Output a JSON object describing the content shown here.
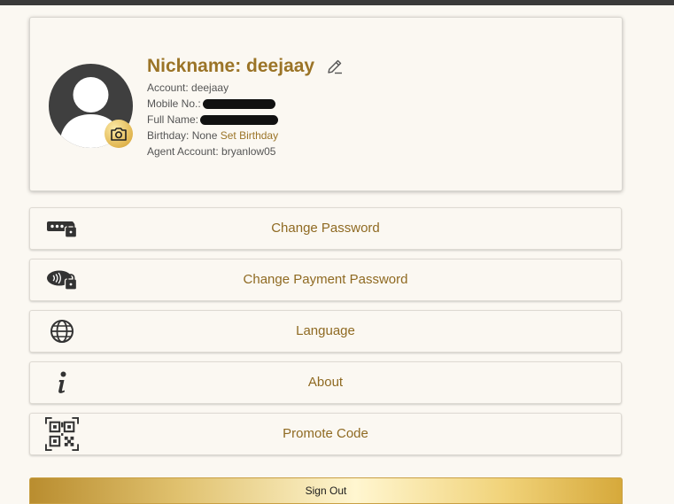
{
  "profile": {
    "nickname": "Nickname: deejaay",
    "account": "Account: deejaay",
    "mobile_label": "Mobile No.:",
    "fullname_label": "Full Name:",
    "birthday_label": "Birthday: None",
    "set_birthday": "Set Birthday",
    "agent_account": "Agent Account: bryanlow05"
  },
  "menu": {
    "change_password": "Change Password",
    "change_payment_password": "Change Payment Password",
    "language": "Language",
    "about": "About",
    "promote_code": "Promote Code"
  },
  "signout_label": "Sign Out",
  "colors": {
    "accent": "#9b7427",
    "background": "#fbf8f2",
    "gold": "#e1b650"
  }
}
